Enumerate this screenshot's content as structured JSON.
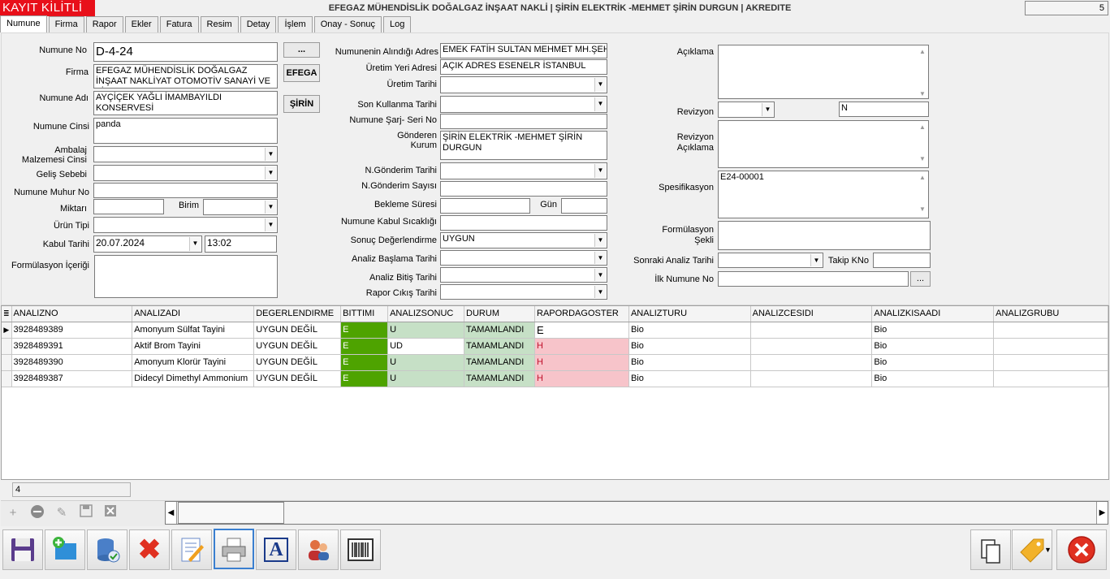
{
  "header": {
    "lock_status": "KAYIT KİLİTLİ",
    "title": "EFEGAZ MÜHENDİSLİK DOĞALGAZ İNŞAAT NAKLİ | ŞİRİN ELEKTRİK -MEHMET ŞİRİN DURGUN | AKREDITE",
    "counter": "5"
  },
  "tabs": [
    "Numune",
    "Firma",
    "Rapor",
    "Ekler",
    "Fatura",
    "Resim",
    "Detay",
    "İşlem",
    "Onay - Sonuç",
    "Log"
  ],
  "left": {
    "numune_no_label": "Numune No",
    "numune_no": "D-4-24",
    "firma_label": "Firma",
    "firma": "EFEGAZ MÜHENDİSLİK DOĞALGAZ İNŞAAT NAKLİYAT OTOMOTİV SANAYİ VE TİCARET",
    "numune_adi_label": "Numune Adı",
    "numune_adi": "AYÇİÇEK YAĞLI İMAMBAYILDI KONSERVESİ",
    "numune_cinsi_label": "Numune Cinsi",
    "numune_cinsi": "panda",
    "ambalaj_label1": "Ambalaj",
    "ambalaj_label2": "Malzemesi Cinsi",
    "ambalaj": "",
    "gelis_label": "Geliş Sebebi",
    "gelis": "",
    "muhur_label": "Numune Muhur No",
    "muhur": "",
    "miktar_label": "Miktarı",
    "miktar": "",
    "birim_label": "Birim",
    "birim": "",
    "urun_tipi_label": "Ürün Tipi",
    "urun_tipi": "",
    "kabul_label": "Kabul Tarihi",
    "kabul_tarihi": "20.07.2024",
    "kabul_saat": "13:02",
    "formulasyon_label": "Formülasyon İçeriği",
    "formulasyon": "",
    "dots_button": "...",
    "efega_button": "EFEGA",
    "sirin_button": "ŞİRİN"
  },
  "middle": {
    "alindigi_label": "Numunenin Alındığı Adres",
    "alindigi": "EMEK FATİH SULTAN MEHMET MH.ŞEH",
    "uretim_yeri_label": "Üretim Yeri Adresi",
    "uretim_yeri": "AÇIK ADRES ESENELR İSTANBUL",
    "uretim_tarihi_label": "Üretim Tarihi",
    "uretim_tarihi": "",
    "son_kullanma_label": "Son Kullanma Tarihi",
    "son_kullanma": "",
    "sarj_label": "Numune Şarj- Seri No",
    "sarj": "",
    "gonderen_label1": "Gönderen",
    "gonderen_label2": "Kurum",
    "gonderen": "ŞİRİN ELEKTRİK -MEHMET ŞİRİN DURGUN",
    "ngonderim_tarihi_label": "N.Gönderim Tarihi",
    "ngonderim_tarihi": "",
    "ngonderim_sayisi_label": "N.Gönderim Sayısı",
    "ngonderim_sayisi": "",
    "bekleme_label": "Bekleme Süresi",
    "bekleme": "",
    "gun_label": "Gün",
    "gun": "",
    "sicaklik_label": "Numune Kabul Sıcaklığı",
    "sicaklik": "",
    "sonuc_label": "Sonuç Değerlendirme",
    "sonuc": "UYGUN",
    "analiz_baslama_label": "Analiz Başlama Tarihi",
    "analiz_baslama": "",
    "analiz_bitis_label": "Analiz Bitiş Tarihi",
    "analiz_bitis": "",
    "rapor_cikis_label": "Rapor Cıkış Tarihi",
    "rapor_cikis": ""
  },
  "right": {
    "aciklama_label": "Açıklama",
    "aciklama": "",
    "revizyon_label": "Revizyon",
    "revizyon": "",
    "revizyon_flag": "N",
    "revizyon_aciklama_label1": "Revizyon",
    "revizyon_aciklama_label2": "Açıklama",
    "revizyon_aciklama": "",
    "spesifikasyon_label": "Spesifikasyon",
    "spesifikasyon": "E24-00001",
    "formulasyon_sekli_label1": "Formülasyon",
    "formulasyon_sekli_label2": "Şekli",
    "formulasyon_sekli": "",
    "sonraki_label": "Sonraki Analiz Tarihi",
    "sonraki": "",
    "takip_label": "Takip KNo",
    "takip": "",
    "ilk_numune_label": "İlk Numune No",
    "ilk_numune": "",
    "dots_button": "..."
  },
  "grid": {
    "columns": [
      "ANALIZNO",
      "ANALIZADI",
      "DEGERLENDIRME",
      "BITTIMI",
      "ANALIZSONUC",
      "DURUM",
      "RAPORDAGOSTER",
      "ANALIZTURU",
      "ANALIZCESIDI",
      "ANALIZKISAADI",
      "ANALIZGRUBU"
    ],
    "rows": [
      {
        "analizno": "3928489389",
        "analizadi": "Amonyum Sülfat Tayini",
        "degerlendirme": "UYGUN DEĞİL",
        "bittimi": "E",
        "analizsonuc": "U",
        "durum": "TAMAMLANDI",
        "rapordagoster": "E",
        "analizturu": "Bio",
        "analizcesidi": "",
        "analizkisaadi": "Bio",
        "analizgrubu": ""
      },
      {
        "analizno": "3928489391",
        "analizadi": "Aktif Brom Tayini",
        "degerlendirme": "UYGUN DEĞİL",
        "bittimi": "E",
        "analizsonuc": "UD",
        "durum": "TAMAMLANDI",
        "rapordagoster": "H",
        "analizturu": "Bio",
        "analizcesidi": "",
        "analizkisaadi": "Bio",
        "analizgrubu": ""
      },
      {
        "analizno": "3928489390",
        "analizadi": "Amonyum Klorür Tayini",
        "degerlendirme": "UYGUN DEĞİL",
        "bittimi": "E",
        "analizsonuc": "U",
        "durum": "TAMAMLANDI",
        "rapordagoster": "H",
        "analizturu": "Bio",
        "analizcesidi": "",
        "analizkisaadi": "Bio",
        "analizgrubu": ""
      },
      {
        "analizno": "3928489387",
        "analizadi": "Didecyl Dimethyl Ammonium",
        "degerlendirme": "UYGUN DEĞİL",
        "bittimi": "E",
        "analizsonuc": "U",
        "durum": "TAMAMLANDI",
        "rapordagoster": "H",
        "analizturu": "Bio",
        "analizcesidi": "",
        "analizkisaadi": "Bio",
        "analizgrubu": ""
      }
    ],
    "row_count": "4"
  },
  "colors": {
    "lock": "#e8101a",
    "bittimi": "#4ea300",
    "sonuc_ok": "#c6e0c6",
    "rapor_h": "#f7c4ca"
  },
  "icons": {
    "nav": [
      "plus-icon",
      "minus-icon",
      "edit-icon",
      "save-icon",
      "cancel-icon"
    ],
    "toolbar": [
      "floppy-icon",
      "new-folder-icon",
      "database-icon",
      "delete-icon",
      "edit-document-icon",
      "printer-icon",
      "font-icon",
      "users-icon",
      "barcode-icon"
    ],
    "toolbar_right": [
      "copy-icon",
      "tag-icon",
      "close-icon"
    ]
  }
}
